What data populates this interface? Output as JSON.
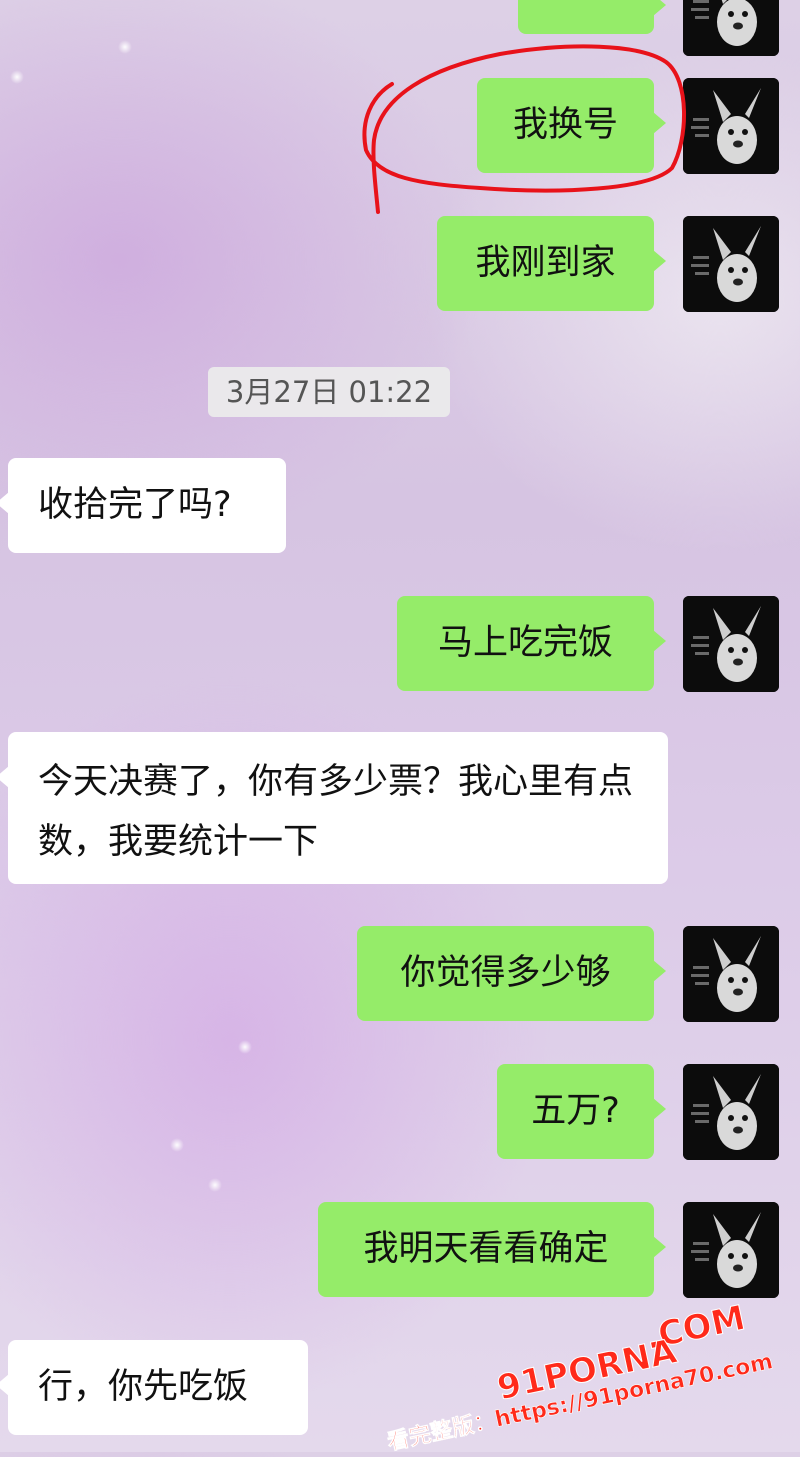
{
  "timestamp": "3月27日 01:22",
  "messages": [
    {
      "id": "m0",
      "dir": "out",
      "text": ""
    },
    {
      "id": "m1",
      "dir": "out",
      "text": "我换号",
      "annotated": true
    },
    {
      "id": "m2",
      "dir": "out",
      "text": "我刚到家"
    },
    {
      "id": "m3",
      "dir": "in",
      "text": "收拾完了吗?"
    },
    {
      "id": "m4",
      "dir": "out",
      "text": "马上吃完饭"
    },
    {
      "id": "m5",
      "dir": "in",
      "text": "今天决赛了，你有多少票？我心里有点数，我要统计一下"
    },
    {
      "id": "m6",
      "dir": "out",
      "text": "你觉得多少够"
    },
    {
      "id": "m7",
      "dir": "out",
      "text": "五万?"
    },
    {
      "id": "m8",
      "dir": "out",
      "text": "我明天看看确定"
    },
    {
      "id": "m9",
      "dir": "in",
      "text": "行，你先吃饭"
    }
  ],
  "watermark": {
    "brand": "91PORNA",
    "domain": ".COM",
    "caption": "看完整版：https://91porna70.com"
  },
  "colors": {
    "outgoing_bubble": "#95ec69",
    "incoming_bubble": "#ffffff",
    "annotation": "#e8121a",
    "watermark": "#ff2a1a"
  },
  "icons": {
    "avatar": "dog-photo-avatar"
  }
}
